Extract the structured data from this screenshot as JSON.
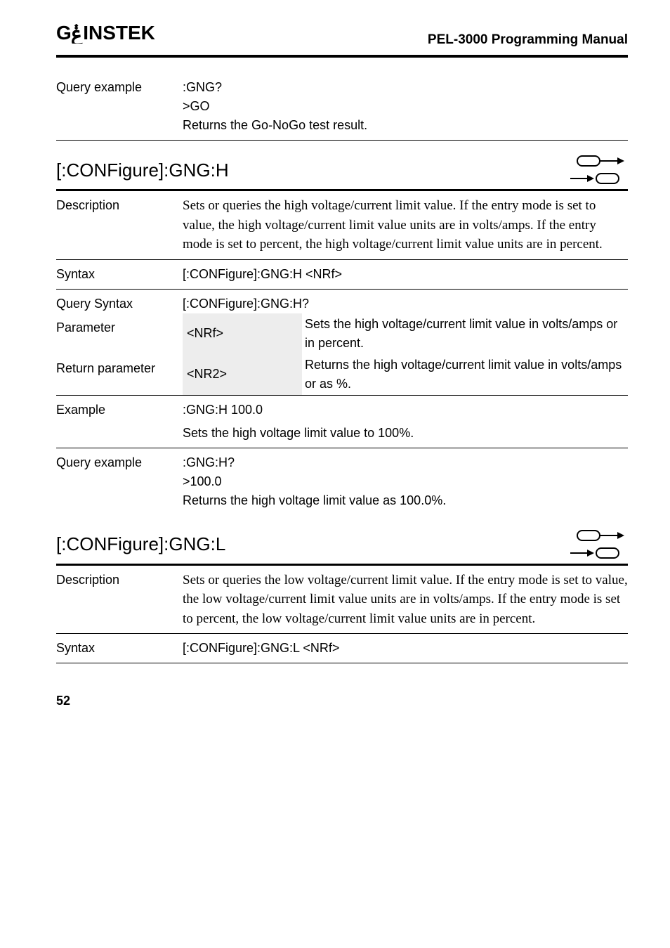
{
  "brand": "G⚡INSTEK",
  "manual_title": "PEL-3000 Programming Manual",
  "page_number": "52",
  "query_example_top": {
    "label": "Query example",
    "cmd": ":GNG?",
    "resp": ">GO",
    "note": "Returns the Go-NoGo test result."
  },
  "section_gngh": {
    "title": "[:CONFigure]:GNG:H",
    "description": {
      "label": "Description",
      "text": "Sets or queries the high voltage/current limit value. If the entry mode is set to value, the high voltage/current limit value units are in volts/amps. If the entry mode is set to percent, the high voltage/current limit value units are in percent."
    },
    "syntax": {
      "label": "Syntax",
      "text": "[:CONFigure]:GNG:H <NRf>"
    },
    "query_syntax": {
      "label": "Query Syntax",
      "text": "[:CONFigure]:GNG:H?"
    },
    "parameter": {
      "label": "Parameter",
      "param": "<NRf>",
      "desc": "Sets the high voltage/current limit value in volts/amps or in percent."
    },
    "return_parameter": {
      "label": "Return parameter",
      "param": "<NR2>",
      "desc": "Returns the high voltage/current limit value in volts/amps or as %."
    },
    "example": {
      "label": "Example",
      "cmd": ":GNG:H 100.0",
      "note": "Sets the high voltage limit value to 100%."
    },
    "query_example": {
      "label": "Query example",
      "cmd": ":GNG:H?",
      "resp": ">100.0",
      "note": "Returns the high voltage limit value as 100.0%."
    }
  },
  "section_gngl": {
    "title": "[:CONFigure]:GNG:L",
    "description": {
      "label": "Description",
      "text": "Sets or queries the low voltage/current limit value. If the entry mode is set to value, the low voltage/current limit value units are in volts/amps. If the entry mode is set to percent, the low voltage/current limit value units are in percent."
    },
    "syntax": {
      "label": "Syntax",
      "text": "[:CONFigure]:GNG:L <NRf>"
    }
  }
}
